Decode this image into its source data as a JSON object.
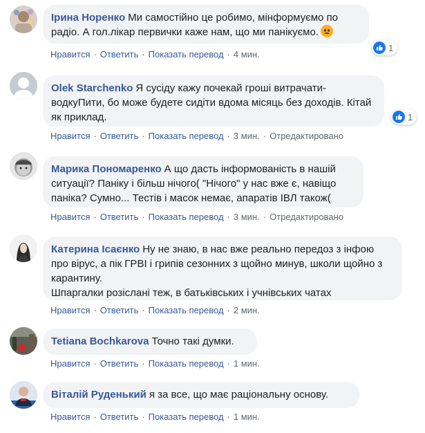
{
  "actions": {
    "like": "Нравится",
    "reply": "Ответить",
    "translate": "Показать перевод",
    "edited": "Отредактировано",
    "separator": "·"
  },
  "comments": [
    {
      "author": "Ірина Норенко",
      "text": "Ми самостійно це робимо, мінформуємо по радіо. А гол.лікар первички каже нам, що ми панікуємо.",
      "time": "4 мин.",
      "reactions": "1"
    },
    {
      "author": "Olek Starchenko",
      "text": "Я сусіду кажу почекай гроші витрачати-водкуПити, бо може будете сидіти вдома місяць без доходів. Кітай як приклад.",
      "time": "3 мин.",
      "reactions": "1"
    },
    {
      "author": "Марика Пономаренко",
      "text": "А що дасть інформованість в нашій ситуації? Паніку і більш нічого( \"Нічого\" у нас вже є, навіщо паніка? Сумно... Тестів і масок немає, апаратів ІВЛ також(",
      "time": "3 мин."
    },
    {
      "author": "Катерина Ісаєнко",
      "text": "Ну не знаю, в нас вже реально передоз з інфою про вірус, а пік ГРВІ і грипів сезонних з щойно минув, школи щойно з карантину.",
      "text2": "Шпаргалки розіслані теж, в батьківських і учнівських чатах",
      "time": "2 мин."
    },
    {
      "author": "Tetiana Bochkarova",
      "text": "Точно такі думки.",
      "time": "1 мин."
    },
    {
      "author": "Віталій Руденький",
      "text": "я за все, що має раціональну основу.",
      "time": "1 мин."
    }
  ]
}
